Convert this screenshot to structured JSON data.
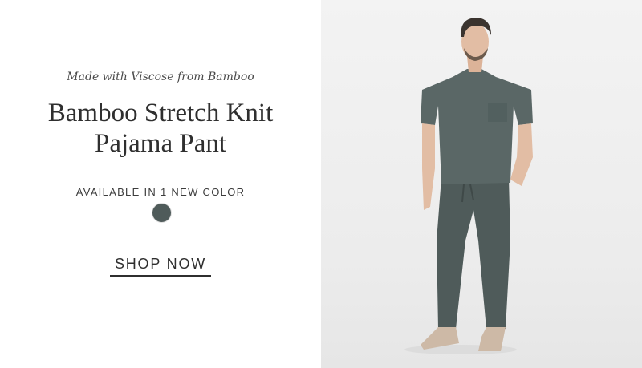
{
  "promo": {
    "eyebrow": "Made with Viscose from Bamboo",
    "title_line1": "Bamboo Stretch Knit",
    "title_line2": "Pajama Pant",
    "availability": "AVAILABLE IN 1 NEW COLOR",
    "swatch_color": "#4f5b5a",
    "cta_label": "SHOP NOW"
  },
  "photo": {
    "subject": "product-model-photo",
    "garment_color": "#4f5b5a"
  }
}
